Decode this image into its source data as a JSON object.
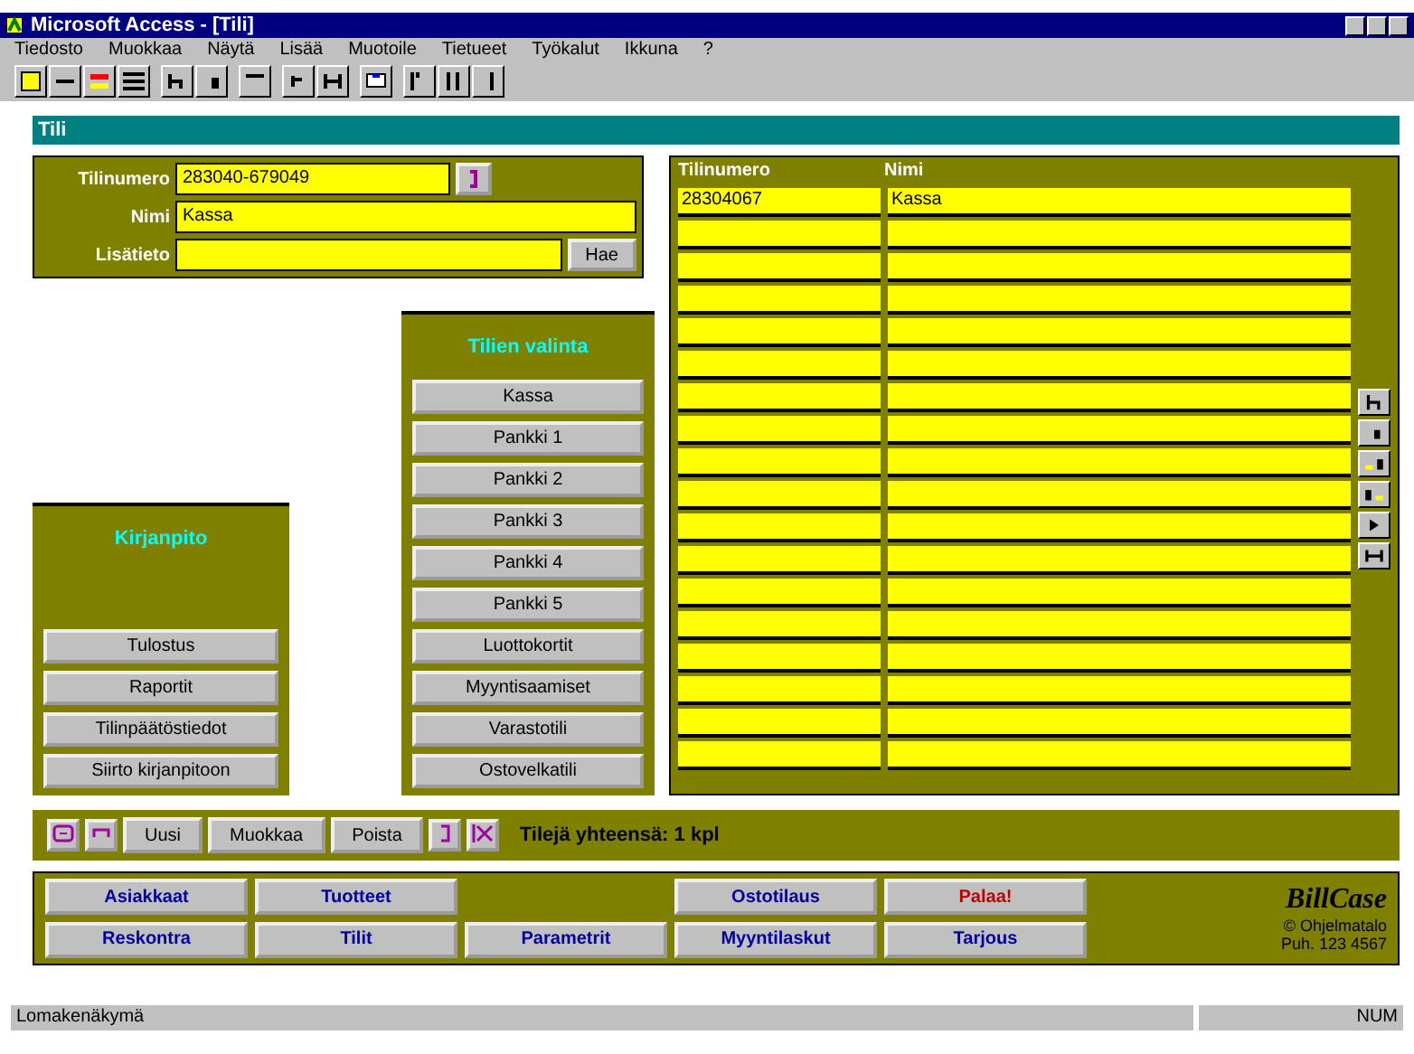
{
  "window": {
    "title": "Microsoft Access - [Tili]"
  },
  "menu": [
    "Tiedosto",
    "Muokkaa",
    "Näytä",
    "Lisää",
    "Muotoile",
    "Tietueet",
    "Työkalut",
    "Ikkuna",
    "?"
  ],
  "form": {
    "title": "Tili",
    "fields": [
      {
        "label": "Tilinumero",
        "value": "283040-679049",
        "kind": "lookup"
      },
      {
        "label": "Nimi",
        "value": "Kassa",
        "kind": "text"
      },
      {
        "label": "Lisätieto",
        "kind": "action",
        "button": "Hae"
      }
    ]
  },
  "accounts_table": {
    "columns": [
      "Tilinumero",
      "Nimi"
    ],
    "rows": [
      [
        "28304067",
        "Kassa"
      ]
    ]
  },
  "bookkeeping": {
    "title": "Kirjanpito",
    "buttons": [
      "Tulostus",
      "Raportit",
      "Tilinpäätöstiedot",
      "Siirto kirjanpitoon"
    ]
  },
  "account_selection": {
    "title": "Tilien valinta",
    "buttons": [
      "Kassa",
      "Pankki 1",
      "Pankki 2",
      "Pankki 3",
      "Pankki 4",
      "Pankki 5",
      "Luottokortit",
      "Myyntisaamiset",
      "Varastotili",
      "Ostovelkatili"
    ]
  },
  "record_bar": {
    "buttons": [
      "Uusi",
      "Muokkaa",
      "Poista"
    ],
    "count": "Tilejä yhteensä: 1 kpl"
  },
  "nav_rows": [
    [
      {
        "kind": "button",
        "label": "Asiakkaat",
        "color": "#0000a0"
      },
      {
        "kind": "button",
        "label": "Tuotteet",
        "color": "#0000a0"
      },
      {
        "kind": "spacer"
      },
      {
        "kind": "button",
        "label": "Ostotilaus",
        "color": "#0000a0"
      },
      {
        "kind": "button",
        "label": "Palaa!",
        "color": "#c00000"
      }
    ],
    [
      {
        "kind": "button",
        "label": "Reskontra",
        "color": "#0000a0"
      },
      {
        "kind": "button",
        "label": "Tilit",
        "color": "#0000a0"
      },
      {
        "kind": "button",
        "label": "Parametrit",
        "color": "#0000a0"
      },
      {
        "kind": "button",
        "label": "Myyntilaskut",
        "color": "#0000a0"
      },
      {
        "kind": "button",
        "label": "Tarjous",
        "color": "#0000a0"
      }
    ]
  ],
  "logo": {
    "name": "BillCase",
    "lines": [
      "© Ohjelmatalo",
      "Puh. 123 4567"
    ]
  },
  "status_bar": {
    "text": "Lomakenäkymä",
    "right": "NUM"
  }
}
